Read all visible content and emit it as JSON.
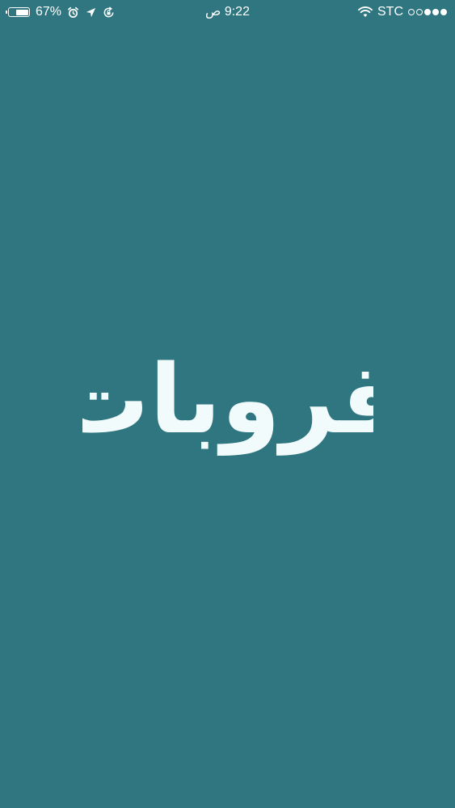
{
  "status_bar": {
    "battery_percent_label": "67%",
    "battery_level": 0.67,
    "time": "9:22",
    "am_pm": "ص",
    "carrier": "STC",
    "signal_bars_filled": 3,
    "signal_bars_total": 5,
    "icons": [
      "battery-icon",
      "alarm-icon",
      "location-arrow-icon",
      "rotation-lock-icon",
      "wifi-icon"
    ]
  },
  "splash": {
    "app_logo_text": "قروبات",
    "background_color": "#2f7680",
    "logo_color": "#f1fbfb"
  }
}
